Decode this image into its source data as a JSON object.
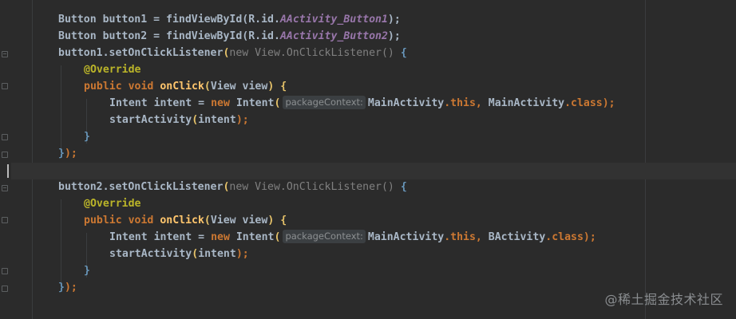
{
  "code": {
    "line1": {
      "type": "Button",
      "var": "button1",
      "eq": " = ",
      "call": "findViewById",
      "open": "(",
      "rid": "R.id.",
      "field": "AActivity_Button1",
      "close": ");"
    },
    "line2": {
      "type": "Button",
      "var": "button2",
      "eq": " = ",
      "call": "findViewById",
      "open": "(",
      "rid": "R.id.",
      "field": "AActivity_Button2",
      "close": ");"
    },
    "block1": {
      "setter": "button1.setOnClickListener",
      "open_paren": "(",
      "new_kw": "new",
      "listener_type": "View.OnClickListener",
      "parens": "()",
      "brace_open": "{",
      "annotation": "@Override",
      "public_kw": "public",
      "void_kw": "void",
      "method": "onClick",
      "params_open": "(",
      "params": "View view",
      "params_close": ")",
      "method_brace_open": "{",
      "intent_type": "Intent",
      "intent_var": "intent",
      "intent_eq": " = ",
      "intent_new": "new",
      "intent_ctor": "Intent",
      "ctor_open": "(",
      "hint": "packageContext:",
      "ctx_class": "MainActivity",
      "this_kw": ".this",
      "comma": ", ",
      "target_class": "MainActivity",
      "class_kw": ".class",
      "ctor_close": ");",
      "start_call": "startActivity",
      "start_open": "(",
      "start_arg": "intent",
      "start_close": ");",
      "method_brace_close": "}",
      "block_close_brace": "}",
      "block_close_rest": ");"
    },
    "block2": {
      "setter": "button2.setOnClickListener",
      "open_paren": "(",
      "new_kw": "new",
      "listener_type": "View.OnClickListener",
      "parens": "()",
      "brace_open": "{",
      "annotation": "@Override",
      "public_kw": "public",
      "void_kw": "void",
      "method": "onClick",
      "params_open": "(",
      "params": "View view",
      "params_close": ")",
      "method_brace_open": "{",
      "intent_type": "Intent",
      "intent_var": "intent",
      "intent_eq": " = ",
      "intent_new": "new",
      "intent_ctor": "Intent",
      "ctor_open": "(",
      "hint": "packageContext:",
      "ctx_class": "MainActivity",
      "this_kw": ".this",
      "comma": ", ",
      "target_class": "BActivity",
      "class_kw": ".class",
      "ctor_close": ");",
      "start_call": "startActivity",
      "start_open": "(",
      "start_arg": "intent",
      "start_close": ");",
      "method_brace_close": "}",
      "block_close_brace": "}",
      "block_close_rest": ");"
    }
  },
  "watermark": "@稀土掘金技术社区",
  "colors": {
    "background": "#2b2b2b",
    "keyword": "#cc7832",
    "field": "#9876aa",
    "method": "#ffc66d",
    "annotation": "#bbb529",
    "text": "#a9b7c6"
  }
}
